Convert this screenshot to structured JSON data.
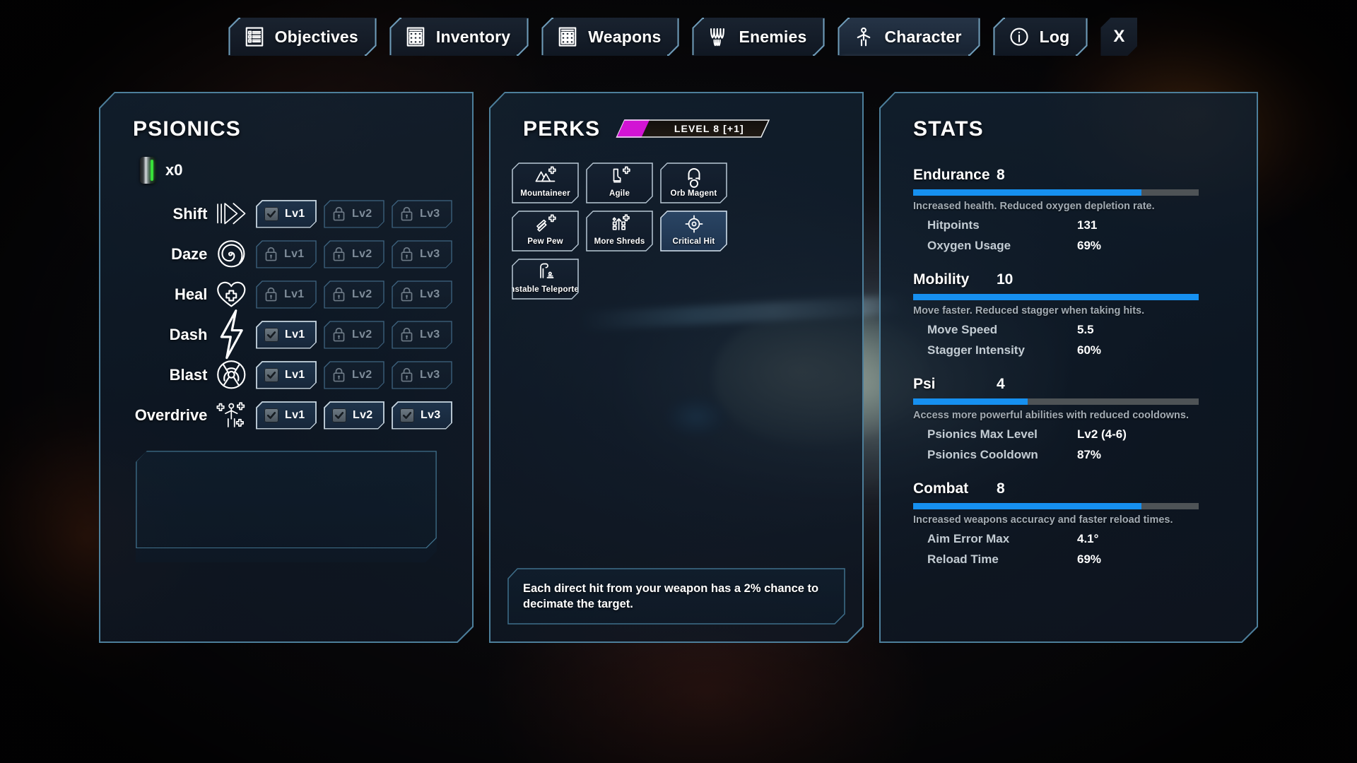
{
  "tabs": [
    {
      "label": "Objectives",
      "icon": "objectives-list-icon",
      "selected": false
    },
    {
      "label": "Inventory",
      "icon": "inventory-grid-icon",
      "selected": false
    },
    {
      "label": "Weapons",
      "icon": "weapons-grid-icon",
      "selected": false
    },
    {
      "label": "Enemies",
      "icon": "enemies-teeth-icon",
      "selected": false
    },
    {
      "label": "Character",
      "icon": "character-person-icon",
      "selected": true
    },
    {
      "label": "Log",
      "icon": "log-info-icon",
      "selected": false
    }
  ],
  "close_button": {
    "label": "X"
  },
  "psionics": {
    "title": "PSIONICS",
    "charge": {
      "icon": "psi-canister-icon",
      "count": "x0"
    },
    "level_labels": [
      "Lv1",
      "Lv2",
      "Lv3"
    ],
    "abilities": [
      {
        "name": "Shift",
        "icon": "shift-arrow-icon",
        "levels": [
          "unlocked",
          "locked",
          "locked"
        ]
      },
      {
        "name": "Daze",
        "icon": "daze-spiral-icon",
        "levels": [
          "locked",
          "locked",
          "locked"
        ]
      },
      {
        "name": "Heal",
        "icon": "heal-heart-icon",
        "levels": [
          "locked",
          "locked",
          "locked"
        ]
      },
      {
        "name": "Dash",
        "icon": "dash-bolt-icon",
        "levels": [
          "unlocked",
          "locked",
          "locked"
        ]
      },
      {
        "name": "Blast",
        "icon": "blast-radial-icon",
        "levels": [
          "unlocked",
          "locked",
          "locked"
        ]
      },
      {
        "name": "Overdrive",
        "icon": "overdrive-buff-icon",
        "levels": [
          "unlocked",
          "unlocked",
          "unlocked"
        ]
      }
    ]
  },
  "perks": {
    "title": "PERKS",
    "level_badge": {
      "text": "LEVEL 8 [+1]",
      "fill_percent": 22,
      "fill_color": "#d214d4"
    },
    "items": [
      {
        "label": "Mountaineer",
        "icon": "mountains-plus-icon",
        "active": false
      },
      {
        "label": "Agile",
        "icon": "boot-plus-icon",
        "active": false
      },
      {
        "label": "Orb Magent",
        "icon": "magnet-orb-icon",
        "active": false
      },
      {
        "label": "Pew Pew",
        "icon": "bullets-plus-icon",
        "active": false
      },
      {
        "label": "More Shreds",
        "icon": "shreds-up-plus-icon",
        "active": false
      },
      {
        "label": "Critical Hit",
        "icon": "crosshair-icon",
        "active": true
      },
      {
        "label": "Unstable Teleporters",
        "icon": "teleporter-icon",
        "active": false
      }
    ],
    "description": "Each direct hit from your weapon has a 2% chance to decimate the target."
  },
  "stats": {
    "title": "STATS",
    "bar_color": "#1690f0",
    "blocks": [
      {
        "name": "Endurance",
        "value": "8",
        "fill_percent": 80,
        "description": "Increased health. Reduced oxygen depletion rate.",
        "subs": [
          {
            "label": "Hitpoints",
            "value": "131"
          },
          {
            "label": "Oxygen Usage",
            "value": "69%"
          }
        ]
      },
      {
        "name": "Mobility",
        "value": "10",
        "fill_percent": 100,
        "description": "Move faster. Reduced stagger when taking hits.",
        "subs": [
          {
            "label": "Move Speed",
            "value": "5.5"
          },
          {
            "label": "Stagger Intensity",
            "value": "60%"
          }
        ]
      },
      {
        "name": "Psi",
        "value": "4",
        "fill_percent": 40,
        "description": "Access more powerful abilities with reduced cooldowns.",
        "subs": [
          {
            "label": "Psionics Max Level",
            "value": "Lv2 (4-6)"
          },
          {
            "label": "Psionics Cooldown",
            "value": "87%"
          }
        ]
      },
      {
        "name": "Combat",
        "value": "8",
        "fill_percent": 80,
        "description": "Increased weapons accuracy and faster reload times.",
        "subs": [
          {
            "label": "Aim Error Max",
            "value": "4.1°"
          },
          {
            "label": "Reload Time",
            "value": "69%"
          }
        ]
      }
    ]
  }
}
